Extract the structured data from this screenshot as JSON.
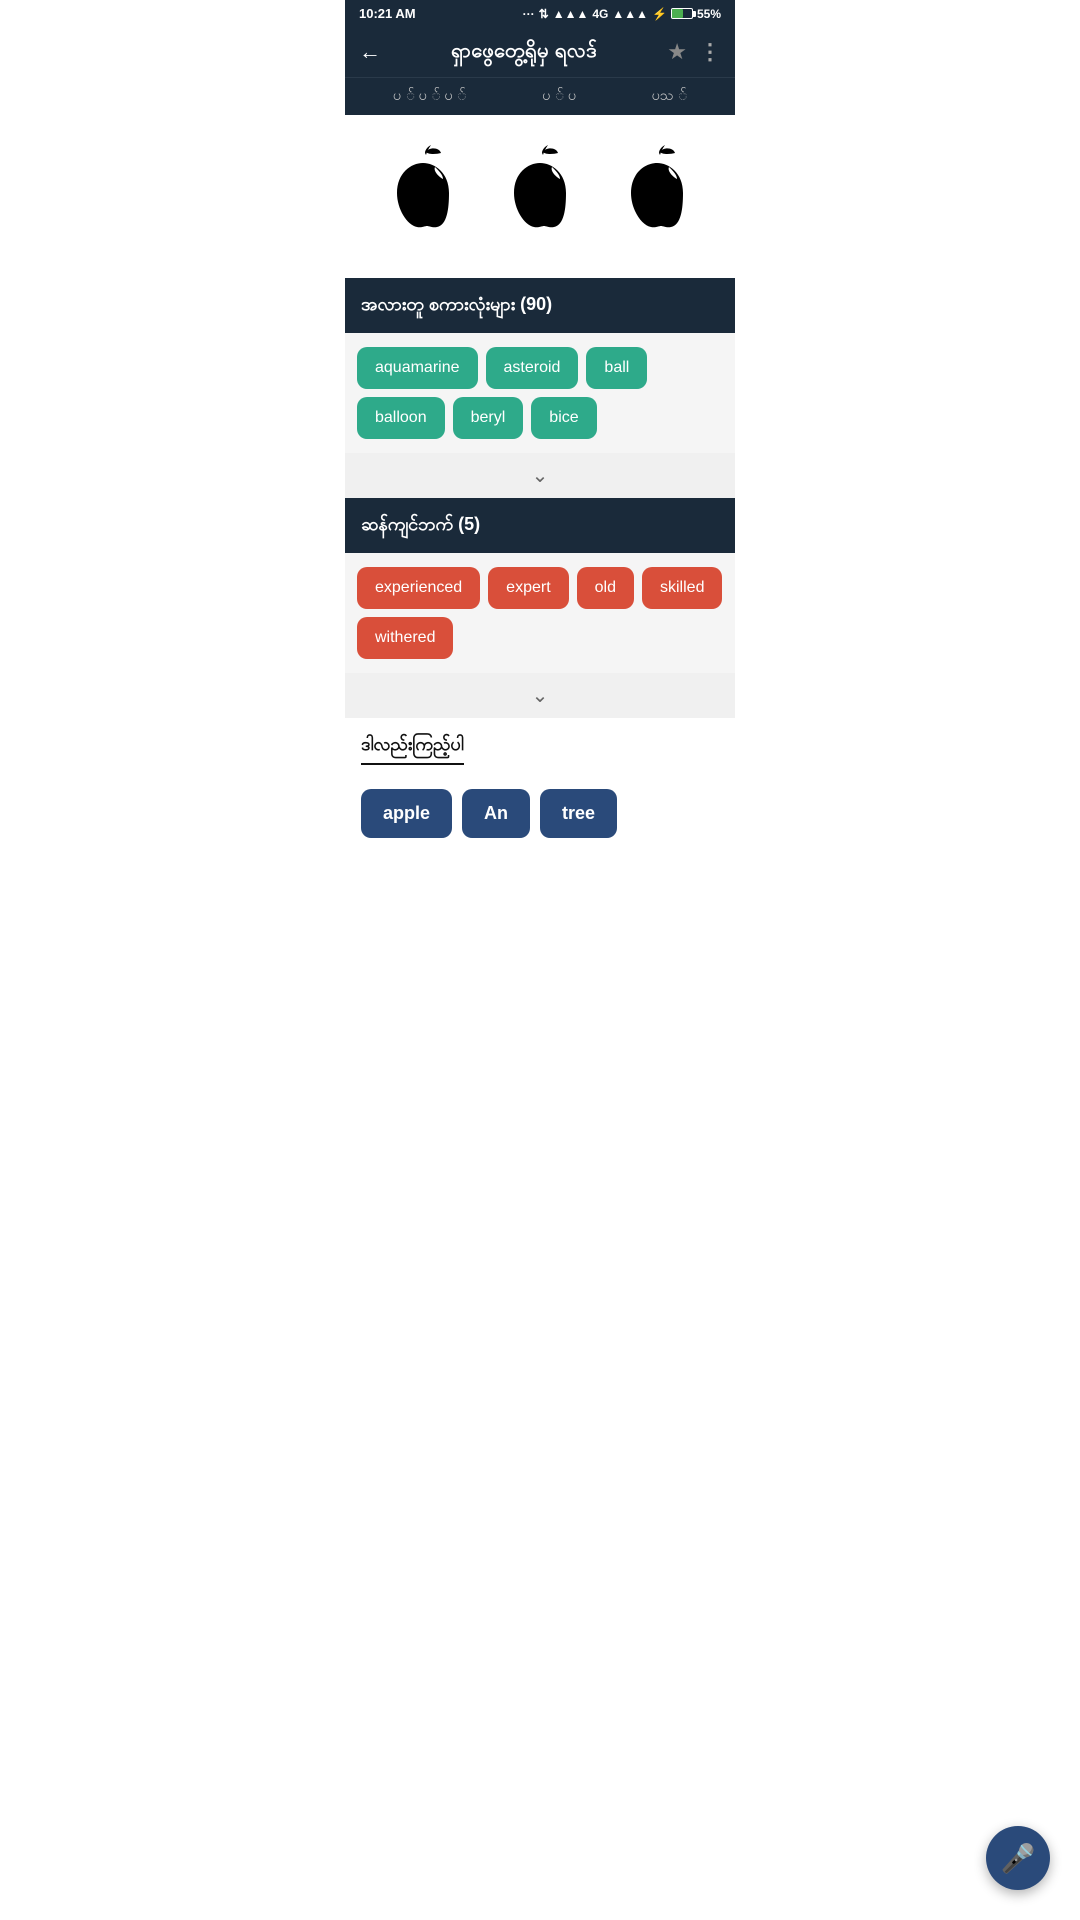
{
  "statusBar": {
    "time": "10:21 AM",
    "signal": "4G",
    "battery": "55%"
  },
  "header": {
    "title": "ရှာဖွေတွေ့ရိုမှ ရလဒ်",
    "backLabel": "←",
    "starLabel": "★",
    "menuLabel": "⋮"
  },
  "subNav": {
    "items": [
      "ပ  ်  ပ  ်  ပ  ်",
      "ပ  ်  ပ",
      "ပသ  ်"
    ]
  },
  "relatedSection": {
    "title": "အလားတူ စကားလုံးများ (90)",
    "tags": [
      "aquamarine",
      "asteroid",
      "ball",
      "balloon",
      "beryl",
      "bice"
    ]
  },
  "synonymSection": {
    "title": "ဆန်ကျင်ဘက် (5)",
    "tags": [
      "experienced",
      "expert",
      "old",
      "skilled",
      "withered"
    ]
  },
  "proverbs": {
    "title": "ဒါလည်းကြည့်ပါ"
  },
  "bottomWords": [
    "apple",
    "An",
    "tree"
  ],
  "icons": {
    "apple": "🍎",
    "mic": "🎤"
  },
  "colors": {
    "teal": "#2eaa8a",
    "red": "#d94f3a",
    "navy": "#1a2a3a",
    "darkBlue": "#2a4a7a"
  }
}
